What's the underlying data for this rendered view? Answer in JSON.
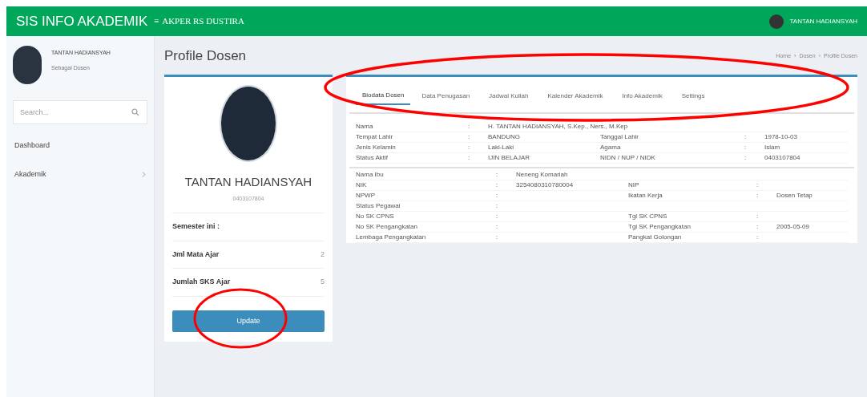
{
  "header": {
    "brand": "SIS INFO AKADEMIK",
    "menu_icon": "≡",
    "institution": "AKPER RS DUSTIRA",
    "user": "TANTAN HADIANSYAH"
  },
  "sidebar": {
    "user_name": "TANTAN HADIANSYAH",
    "user_role": "Sebagai Dosen",
    "search": {
      "placeholder": "Search..."
    },
    "items": [
      {
        "label": "Dashboard",
        "expandable": false
      },
      {
        "label": "Akademik",
        "expandable": true
      }
    ]
  },
  "page_title": "Profile Dosen",
  "breadcrumb": [
    "Home",
    "›",
    "Dosen",
    "›",
    "Profile Dosen"
  ],
  "profile_card": {
    "name": "TANTAN HADIANSYAH",
    "id": "0403107804",
    "semester_label": "Semester ini :",
    "stats": [
      {
        "label": "Jml Mata Ajar",
        "value": "2"
      },
      {
        "label": "Jumlah SKS Ajar",
        "value": "5"
      }
    ],
    "update_button": {
      "label": "Update",
      "highlighted": true
    }
  },
  "tabs": {
    "highlighted": true,
    "items": [
      {
        "label": "Biodata Dosen",
        "selected": true
      },
      {
        "label": "Data Penugasan",
        "selected": false
      },
      {
        "label": "Jadwal Kuliah",
        "selected": false
      },
      {
        "label": "Kalender Akademik",
        "selected": false
      },
      {
        "label": "Info Akademik",
        "selected": false
      },
      {
        "label": "Settings",
        "selected": false
      }
    ]
  },
  "biodata_sections": [
    {
      "rows": [
        [
          {
            "label": "Nama",
            "colon": ":",
            "value": "H. TANTAN HADIANSYAH, S.Kep., Ners., M.Kep"
          }
        ],
        [
          {
            "label": "Tempat Lahir",
            "colon": ":",
            "value": "BANDUNG"
          },
          {
            "label": "Tanggal Lahir",
            "colon": ":",
            "value": "1978-10-03"
          }
        ],
        [
          {
            "label": "Jenis Kelamin",
            "colon": ":",
            "value": "Laki-Laki"
          },
          {
            "label": "Agama",
            "colon": ":",
            "value": "Islam"
          }
        ],
        [
          {
            "label": "Status Aktif",
            "colon": ":",
            "value": "IJIN BELAJAR"
          },
          {
            "label": "NIDN / NUP / NIDK",
            "colon": ":",
            "value": "0403107804"
          }
        ]
      ]
    },
    {
      "rows": [
        [
          {
            "label": "Nama Ibu",
            "colon": ":",
            "value": "Neneng Komariah"
          }
        ],
        [
          {
            "label": "NIK",
            "colon": ":",
            "value": "3254080310780004"
          },
          {
            "label": "NIP",
            "colon": ":"
          }
        ],
        [
          {
            "label": "NPWP",
            "colon": ":"
          },
          {
            "label": "Ikatan Kerja",
            "colon": ":",
            "value": "Dosen Tetap"
          }
        ],
        [
          {
            "label": "Status Pegawai",
            "colon": ":"
          }
        ],
        [
          {
            "label": "No SK CPNS",
            "colon": ":"
          },
          {
            "label": "Tgl SK CPNS",
            "colon": ":"
          }
        ],
        [
          {
            "label": "No SK Pengangkatan",
            "colon": ":"
          },
          {
            "label": "Tgl SK Pengangkatan",
            "colon": ":",
            "value": "2005-05-09"
          }
        ],
        [
          {
            "label": "Lembaga Pengangkatan",
            "colon": ":"
          },
          {
            "label": "Pangkat Golongan",
            "colon": ":"
          }
        ]
      ]
    }
  ]
}
